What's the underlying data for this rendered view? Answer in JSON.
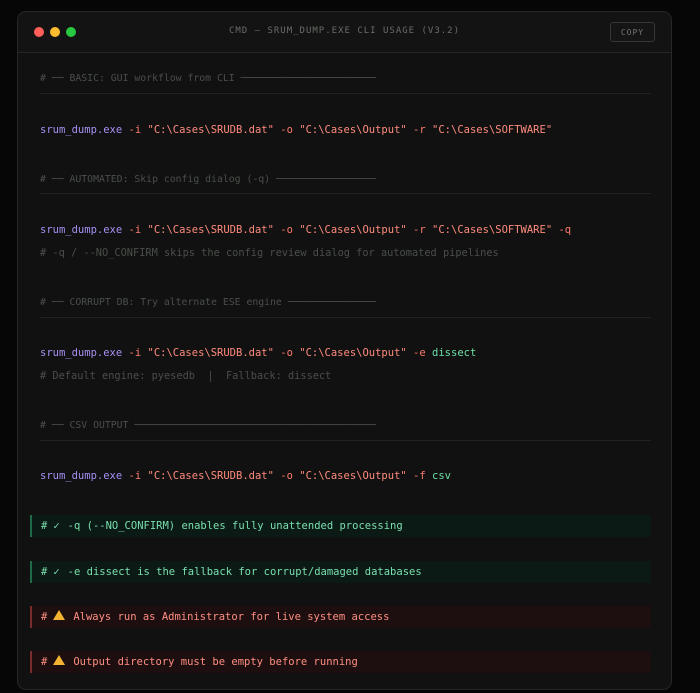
{
  "window": {
    "title": "CMD — SRUM_DUMP.EXE CLI USAGE (V3.2)",
    "copy_label": "COPY"
  },
  "sections": [
    {
      "header": "# ── BASIC: GUI workflow from CLI ───────────────────────",
      "command": {
        "exe": "srum_dump.exe",
        "i_flag": "-i",
        "i_val": "\"C:\\Cases\\SRUDB.dat\"",
        "o_flag": "-o",
        "o_val": "\"C:\\Cases\\Output\"",
        "r_flag": "-r",
        "r_val": "\"C:\\Cases\\SOFTWARE\""
      }
    },
    {
      "header": "# ── AUTOMATED: Skip config dialog (-q) ─────────────────",
      "command": {
        "exe": "srum_dump.exe",
        "i_flag": "-i",
        "i_val": "\"C:\\Cases\\SRUDB.dat\"",
        "o_flag": "-o",
        "o_val": "\"C:\\Cases\\Output\"",
        "r_flag": "-r",
        "r_val": "\"C:\\Cases\\SOFTWARE\"",
        "q_flag": "-q"
      },
      "note": "# -q / --NO_CONFIRM skips the config review dialog for automated pipelines"
    },
    {
      "header": "# ── CORRUPT DB: Try alternate ESE engine ───────────────",
      "command": {
        "exe": "srum_dump.exe",
        "i_flag": "-i",
        "i_val": "\"C:\\Cases\\SRUDB.dat\"",
        "o_flag": "-o",
        "o_val": "\"C:\\Cases\\Output\"",
        "e_flag": "-e",
        "e_val": "dissect"
      },
      "note": "# Default engine: pyesedb  |  Fallback: dissect"
    },
    {
      "header": "# ── CSV OUTPUT ─────────────────────────────────────────",
      "command": {
        "exe": "srum_dump.exe",
        "i_flag": "-i",
        "i_val": "\"C:\\Cases\\SRUDB.dat\"",
        "o_flag": "-o",
        "o_val": "\"C:\\Cases\\Output\"",
        "f_flag": "-f",
        "f_val": "csv"
      }
    }
  ],
  "callouts": [
    {
      "hash": "#",
      "icon": "check-icon",
      "glyph": "✓",
      "text": "-q (--NO_CONFIRM) enables fully unattended processing",
      "color": "#79e0ae"
    },
    {
      "hash": "#",
      "icon": "check-icon",
      "glyph": "✓",
      "text": "-e dissect is the fallback for corrupt/damaged databases",
      "color": "#79e0ae"
    },
    {
      "hash": "#",
      "icon": "warning-icon",
      "text": "Always run as Administrator for live system access",
      "color": "#ff8e80"
    },
    {
      "hash": "#",
      "icon": "warning-icon",
      "text": "Output directory must be empty before running",
      "color": "#ff8e80"
    }
  ]
}
